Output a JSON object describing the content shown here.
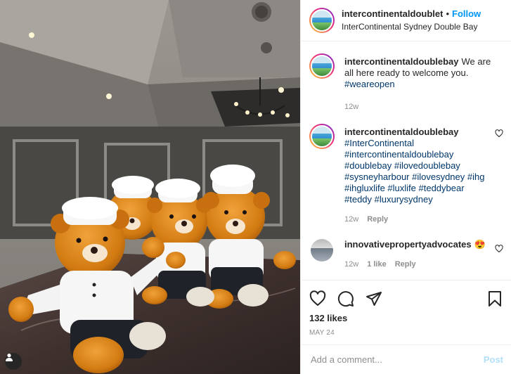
{
  "post": {
    "header": {
      "username": "intercontinentaldoublet",
      "separator": "•",
      "follow_label": "Follow",
      "location": "InterContinental Sydney Double Bay"
    },
    "caption": {
      "username": "intercontinentaldoublebay",
      "text": "We are all here ready to welcome you.",
      "hashtag": "#weareopen",
      "age": "12w"
    },
    "hashtag_comment": {
      "username": "intercontinentaldoublebay",
      "lines": [
        "#InterContinental",
        "#intercontinentaldoublebay",
        "#doublebay #ilovedoublebay",
        "#sysneyharbour #ilovesydney #ihg",
        "#ihgluxlife #luxlife #teddybear",
        "#teddy #luxurysydney"
      ],
      "age": "12w",
      "reply_label": "Reply"
    },
    "user_comment": {
      "username": "innovativepropertyadvocates",
      "text": "😍",
      "age": "12w",
      "likes": "1 like",
      "reply_label": "Reply"
    },
    "likes_text": "132 likes",
    "date": "MAY 24",
    "add_comment": {
      "placeholder": "Add a comment...",
      "post_label": "Post"
    },
    "icons": {
      "like": "heart-icon",
      "comment": "comment-icon",
      "share": "share-icon",
      "save": "bookmark-icon",
      "tags": "user-tag-icon"
    },
    "colors": {
      "accent": "#0095f6",
      "hashtag": "#00376b",
      "muted": "#8e8e8e",
      "post_disabled": "#b2dffc"
    }
  }
}
